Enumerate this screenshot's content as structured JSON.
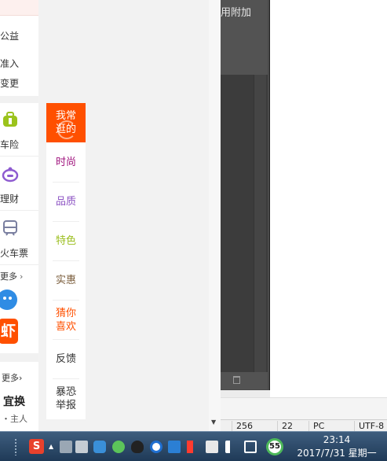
{
  "left_panel": {
    "top_card": {
      "line1": "公益",
      "line2": "准入",
      "line3": "变更"
    },
    "services": [
      {
        "label": "车险",
        "icon": "car-insurance-icon"
      },
      {
        "label": "理财",
        "icon": "piggy-bank-icon"
      },
      {
        "label": "火车票",
        "icon": "train-icon"
      }
    ],
    "more_1": "更多",
    "bottom_card": {
      "more": "更多",
      "big": "宜换",
      "small": "・主人"
    }
  },
  "side_nav": {
    "items": [
      {
        "label_line1": "我常",
        "label_line2": "逛的",
        "color": "#ffffff",
        "active": true
      },
      {
        "label": "时尚",
        "color": "#a1167f"
      },
      {
        "label": "品质",
        "color": "#8c52c3"
      },
      {
        "label": "特色",
        "color": "#9bbe1e"
      },
      {
        "label": "实惠",
        "color": "#7a5c3b"
      },
      {
        "label_line1": "猜你",
        "label_line2": "喜欢",
        "color": "#ff5000"
      },
      {
        "label": "反馈",
        "color": "#333333"
      },
      {
        "label_line1": "暴恐",
        "label_line2": "举报",
        "color": "#333333"
      }
    ]
  },
  "dark_panel": {
    "title": "用附加"
  },
  "status_bar": {
    "c1": "256",
    "c2": "22",
    "c3": "PC",
    "c4": "UTF-8"
  },
  "taskbar": {
    "time": "23:14",
    "date": "2017/7/31 星期一",
    "badge": "55",
    "sogou_label": "S"
  },
  "colors": {
    "accent": "#ff5000",
    "taskbar": "#2a4868"
  }
}
